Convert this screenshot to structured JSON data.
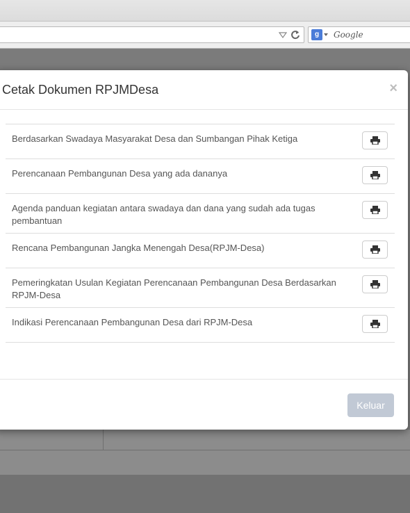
{
  "browser": {
    "search_placeholder": "Google",
    "search_engine_letter": "g"
  },
  "modal": {
    "title": "Cetak Dokumen RPJMDesa",
    "close_glyph": "×",
    "documents": [
      {
        "label": "Berdasarkan Swadaya Masyarakat Desa dan Sumbangan Pihak Ketiga"
      },
      {
        "label": "Perencanaan Pembangunan Desa yang ada dananya"
      },
      {
        "label": "Agenda panduan kegiatan antara swadaya dan dana yang sudah ada tugas pembantuan"
      },
      {
        "label": "Rencana Pembangunan Jangka Menengah Desa(RPJM-Desa)"
      },
      {
        "label": "Pemeringkatan Usulan Kegiatan Perencanaan Pembangunan Desa Berdasarkan RPJM-Desa"
      },
      {
        "label": "Indikasi Perencanaan Pembangunan Desa dari RPJM-Desa"
      }
    ],
    "print_icon": "print-icon",
    "footer": {
      "close_label": "Keluar"
    }
  },
  "colors": {
    "backdrop": "#7b7b7b",
    "button_disabled": "#c1c9d5"
  }
}
